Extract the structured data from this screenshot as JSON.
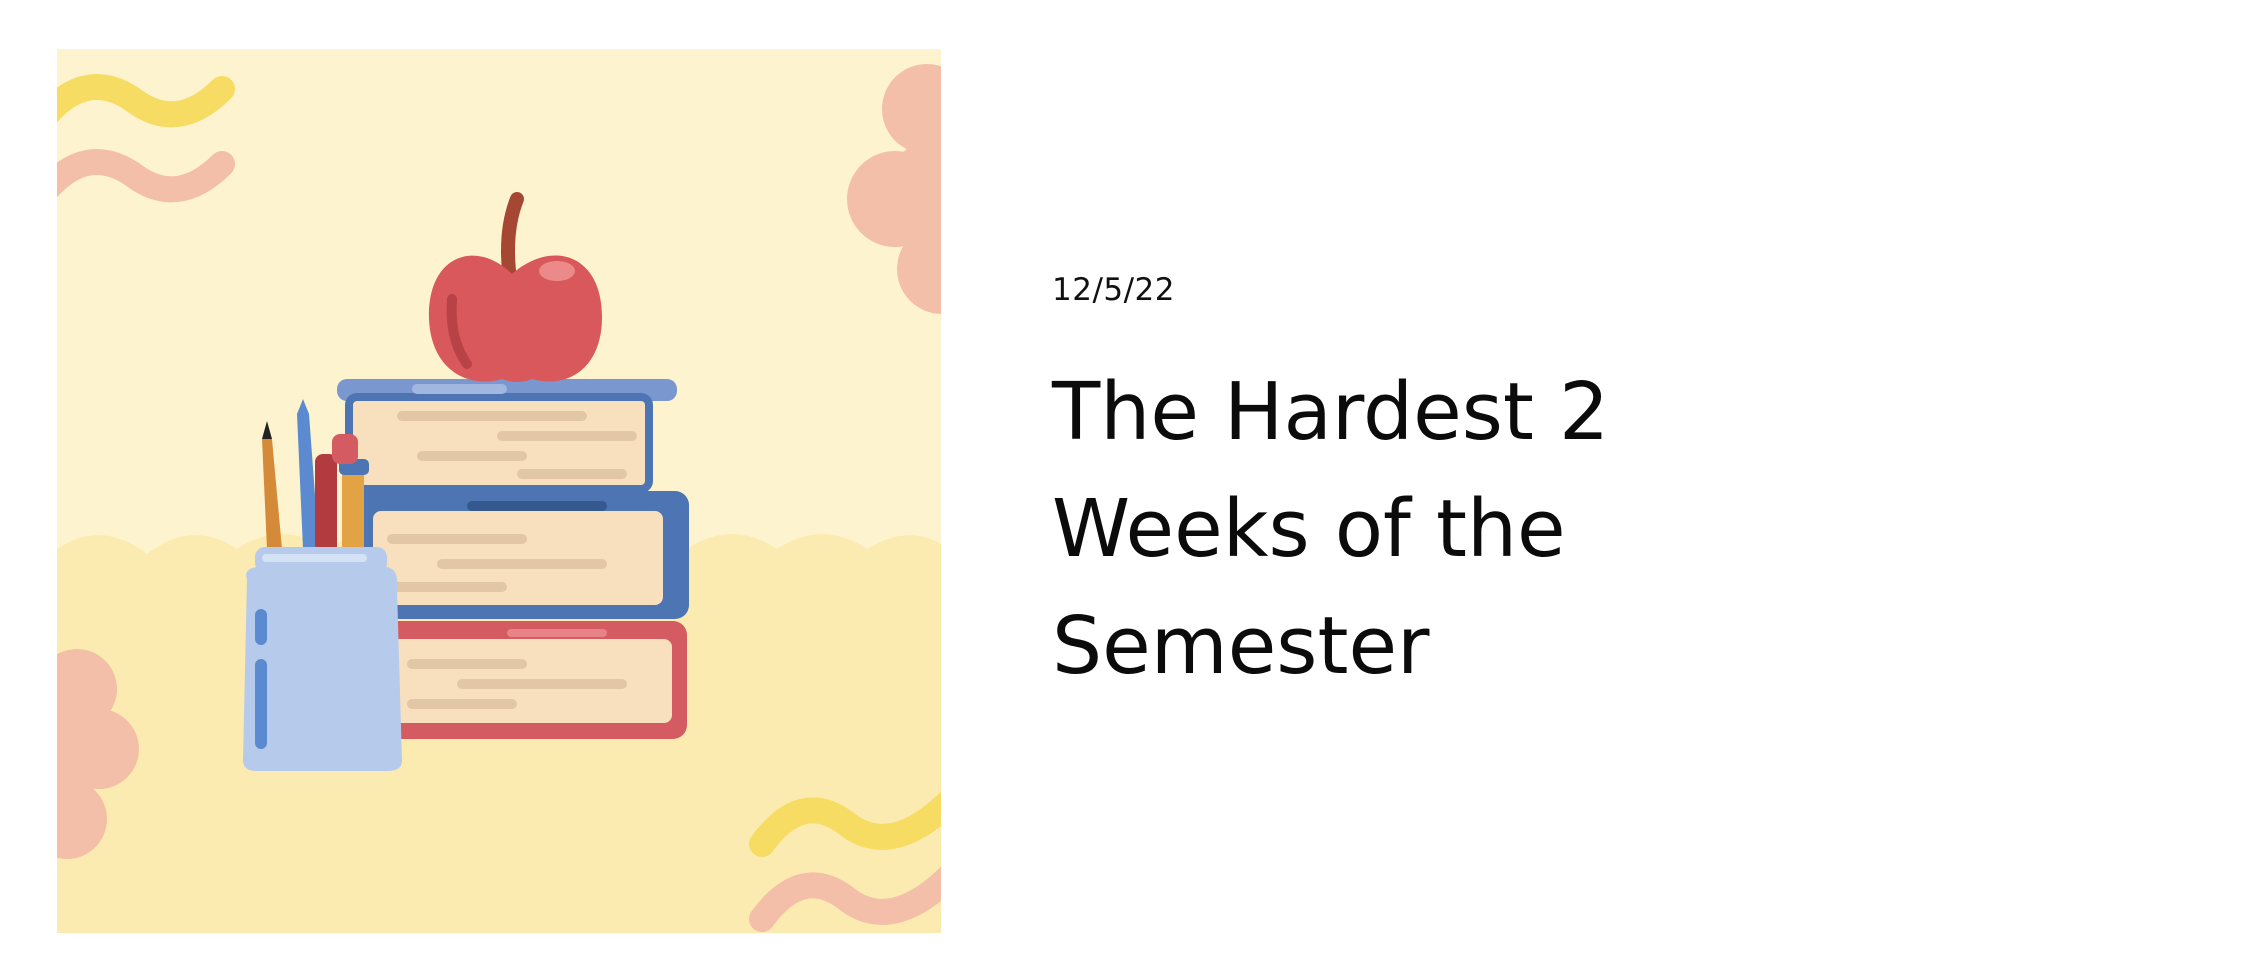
{
  "post": {
    "date": "12/5/22",
    "title": "The Hardest 2 Weeks of the Semester",
    "thumbnail": {
      "icon": "books-apple-pencils-illustration",
      "colors": {
        "background_top": "#fdf4cf",
        "background_bottom": "#fcebb0",
        "squiggle_yellow": "#f6dc63",
        "squiggle_pink": "#f3bfa8",
        "apple": "#d9585b",
        "book_blue": "#4d75b3",
        "book_red": "#d45b62",
        "pages": "#f8dfbd",
        "jar": "#b6cbec"
      }
    }
  }
}
